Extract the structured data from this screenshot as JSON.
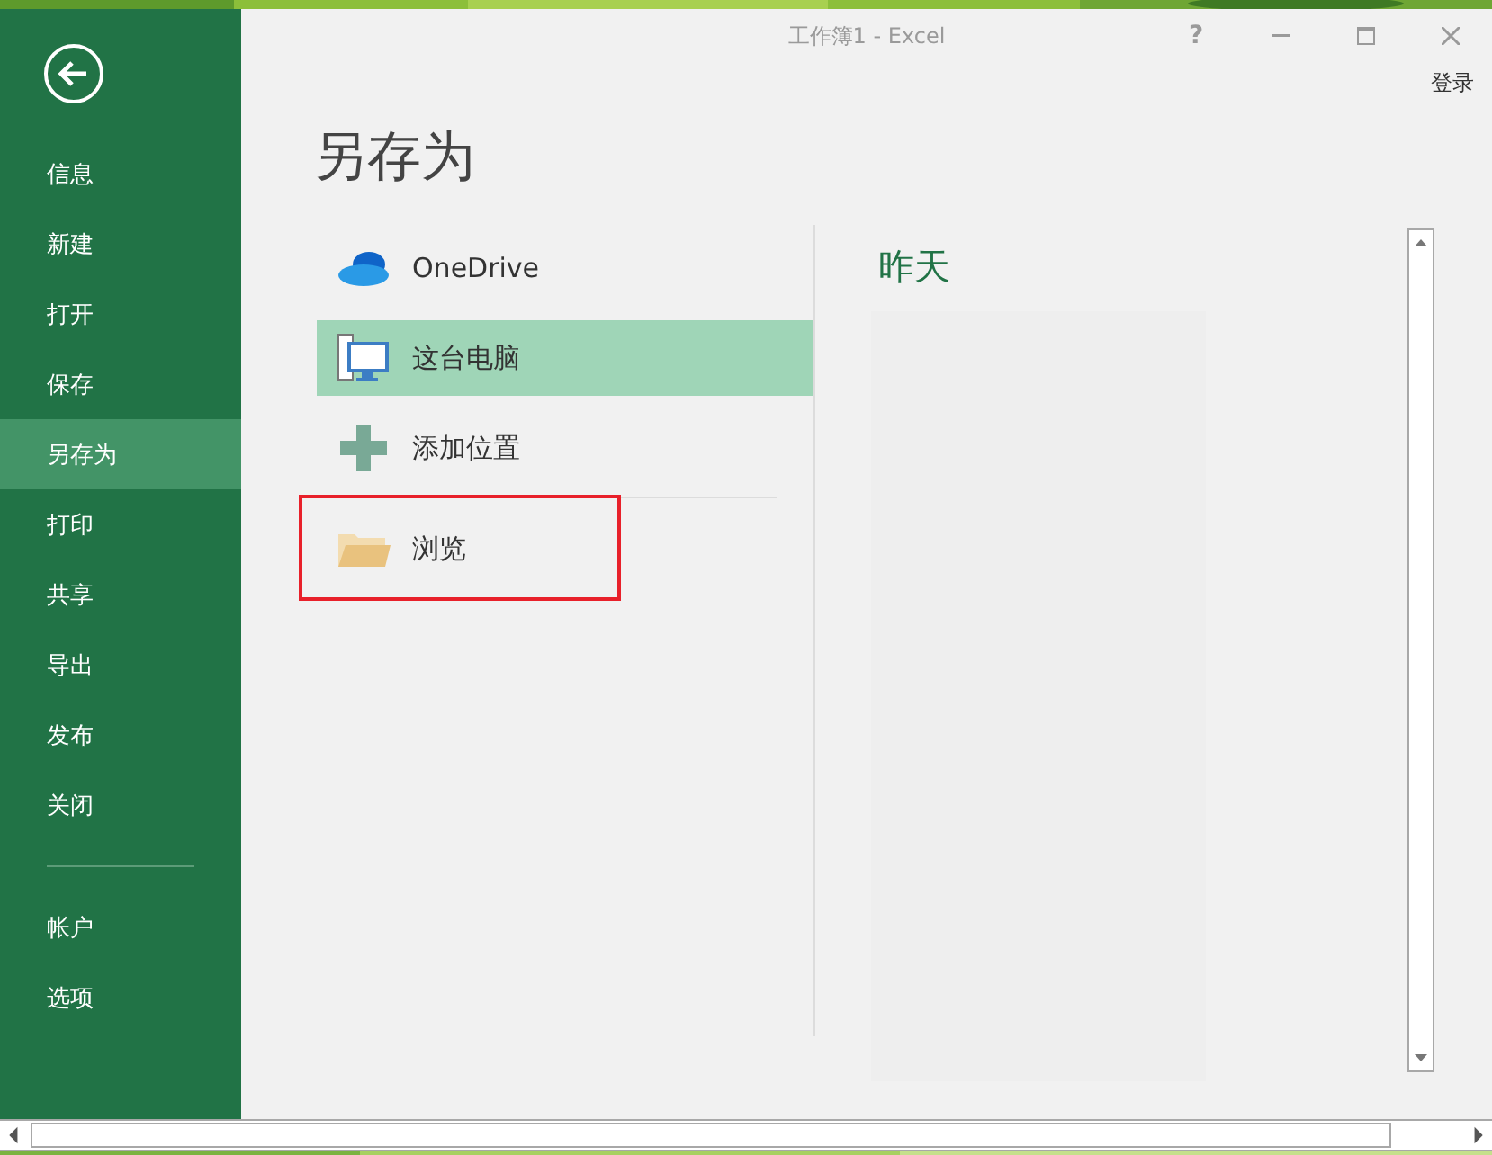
{
  "window": {
    "title": "工作簿1 - Excel",
    "help": "?",
    "sign_in": "登录"
  },
  "sidebar": {
    "items": [
      {
        "label": "信息",
        "selected": false
      },
      {
        "label": "新建",
        "selected": false
      },
      {
        "label": "打开",
        "selected": false
      },
      {
        "label": "保存",
        "selected": false
      },
      {
        "label": "另存为",
        "selected": true
      },
      {
        "label": "打印",
        "selected": false
      },
      {
        "label": "共享",
        "selected": false
      },
      {
        "label": "导出",
        "selected": false
      },
      {
        "label": "发布",
        "selected": false
      },
      {
        "label": "关闭",
        "selected": false
      }
    ],
    "account_items": [
      {
        "label": "帐户",
        "selected": false
      },
      {
        "label": "选项",
        "selected": false
      }
    ]
  },
  "heading": "另存为",
  "locations": [
    {
      "kind": "cloud",
      "label": "OneDrive",
      "selected": false
    },
    {
      "kind": "computer",
      "label": "这台电脑",
      "selected": true
    },
    {
      "kind": "add",
      "label": "添加位置",
      "selected": false
    },
    {
      "kind": "folder",
      "label": "浏览",
      "selected": false,
      "highlighted": true
    }
  ],
  "recent": {
    "heading": "昨天"
  }
}
